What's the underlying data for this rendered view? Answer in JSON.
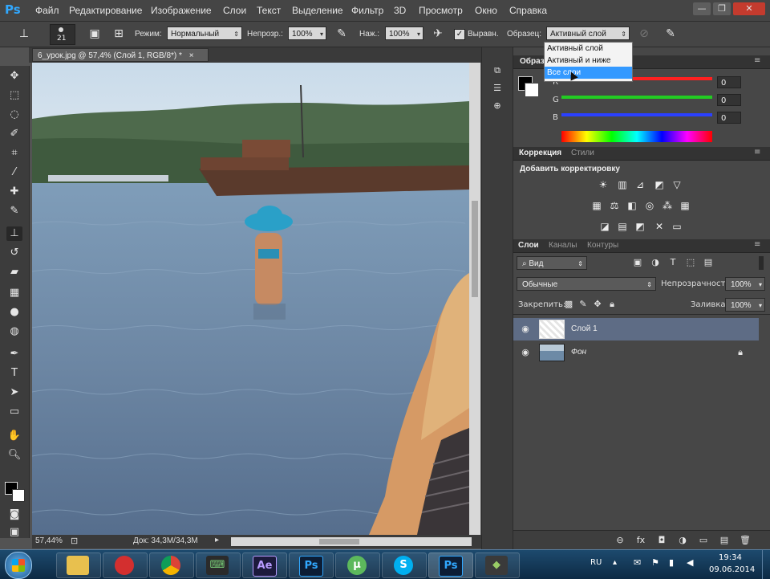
{
  "app": {
    "logo": "Ps"
  },
  "menu": [
    "Файл",
    "Редактирование",
    "Изображение",
    "Слои",
    "Текст",
    "Выделение",
    "Фильтр",
    "3D",
    "Просмотр",
    "Окно",
    "Справка"
  ],
  "window_controls": {
    "minimize": "—",
    "maximize": "❐",
    "close": "✕"
  },
  "options_bar": {
    "brush_size": "21",
    "mode_label": "Режим:",
    "mode_value": "Нормальный",
    "opacity_label": "Непрозр.:",
    "opacity_value": "100%",
    "pressure_label": "Наж.:",
    "pressure_value": "100%",
    "aligned_label": "Выравн.",
    "sample_label": "Образец:",
    "sample_value": "Активный слой",
    "sample_options": [
      "Активный слой",
      "Активный и ниже",
      "Все слои"
    ]
  },
  "document": {
    "tab_title": "6_урок.jpg @ 57,4% (Слой 1, RGB/8*) *",
    "zoom": "57,44%",
    "doc_info": "Док: 34,3M/34,3M"
  },
  "color_panel": {
    "tab": "Образ",
    "channels": [
      {
        "label": "R",
        "value": "0",
        "color": "#ff2020"
      },
      {
        "label": "G",
        "value": "0",
        "color": "#22cc22"
      },
      {
        "label": "B",
        "value": "0",
        "color": "#2a40ff"
      }
    ],
    "channel_r_label": "К"
  },
  "adjustments_panel": {
    "tabs": [
      "Коррекция",
      "Стили"
    ],
    "title": "Добавить корректировку"
  },
  "layers_panel": {
    "tabs": [
      "Слои",
      "Каналы",
      "Контуры"
    ],
    "filter": "Вид",
    "blend_mode": "Обычные",
    "opacity_label": "Непрозрачность:",
    "opacity_value": "100%",
    "lock_label": "Закрепить:",
    "fill_label": "Заливка:",
    "fill_value": "100%",
    "layers": [
      {
        "name": "Слой 1",
        "selected": true
      },
      {
        "name": "Фон",
        "selected": false,
        "locked": true
      }
    ]
  },
  "taskbar": {
    "apps": [
      "explorer",
      "opera",
      "chrome",
      "app4",
      "Ae",
      "Ps",
      "torrent",
      "skype",
      "Ps",
      "app10"
    ],
    "labels": {
      "ae": "Ae",
      "ps": "Ps",
      "ps2": "Ps"
    },
    "lang": "RU",
    "time": "19:34",
    "date": "09.06.2014"
  },
  "colors": {
    "accent": "#3399ff",
    "panel_bg": "#474747",
    "selected_layer": "#5e6c85"
  }
}
